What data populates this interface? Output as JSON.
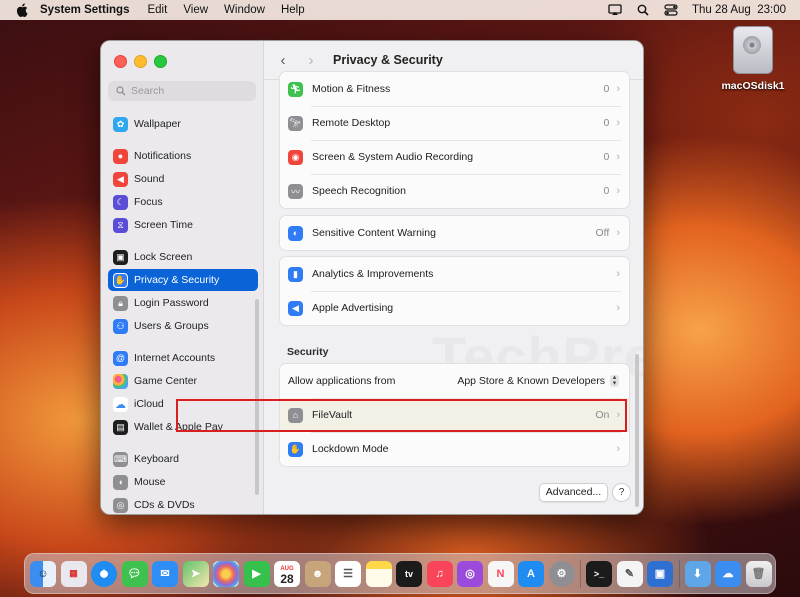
{
  "menubar": {
    "app": "System Settings",
    "items": [
      "Edit",
      "View",
      "Window",
      "Help"
    ],
    "clock": "Thu 28 Aug  23:00"
  },
  "desktop": {
    "disk_label": "macOSdisk1"
  },
  "watermark": "TechPress.net",
  "sidebar": {
    "search_placeholder": "Search",
    "items": [
      {
        "label": "Wallpaper",
        "icon": "wallpaper-icon",
        "color": "#2fa8f0"
      },
      {
        "label": "Notifications",
        "icon": "notifications-icon",
        "color": "#f0453a"
      },
      {
        "label": "Sound",
        "icon": "sound-icon",
        "color": "#f0453a"
      },
      {
        "label": "Focus",
        "icon": "focus-icon",
        "color": "#5b4ed6"
      },
      {
        "label": "Screen Time",
        "icon": "screen-time-icon",
        "color": "#5b4ed6"
      },
      {
        "label": "Lock Screen",
        "icon": "lock-screen-icon",
        "color": "#1e1e1e"
      },
      {
        "label": "Privacy & Security",
        "icon": "privacy-hand-icon",
        "color": "#2f7cf6"
      },
      {
        "label": "Login Password",
        "icon": "login-password-icon",
        "color": "#8e8e93"
      },
      {
        "label": "Users & Groups",
        "icon": "users-groups-icon",
        "color": "#2f7cf6"
      },
      {
        "label": "Internet Accounts",
        "icon": "internet-accounts-icon",
        "color": "#2f7cf6"
      },
      {
        "label": "Game Center",
        "icon": "game-center-icon",
        "color": "#e9e9ee"
      },
      {
        "label": "iCloud",
        "icon": "icloud-icon",
        "color": "#ffffff"
      },
      {
        "label": "Wallet & Apple Pay",
        "icon": "wallet-icon",
        "color": "#1e1e1e"
      },
      {
        "label": "Keyboard",
        "icon": "keyboard-icon",
        "color": "#8e8e93"
      },
      {
        "label": "Mouse",
        "icon": "mouse-icon",
        "color": "#8e8e93"
      },
      {
        "label": "CDs & DVDs",
        "icon": "cds-dvds-icon",
        "color": "#8e8e93"
      }
    ]
  },
  "main": {
    "title": "Privacy & Security",
    "group1": [
      {
        "label": "Motion & Fitness",
        "value": "0",
        "icon": "motion-fitness-icon",
        "color": "#3fc14f"
      },
      {
        "label": "Remote Desktop",
        "value": "0",
        "icon": "remote-desktop-icon",
        "color": "#8e8e93"
      },
      {
        "label": "Screen & System Audio Recording",
        "value": "0",
        "icon": "screen-recording-icon",
        "color": "#f0453a"
      },
      {
        "label": "Speech Recognition",
        "value": "0",
        "icon": "speech-recognition-icon",
        "color": "#8e8e93"
      }
    ],
    "sensitive": {
      "label": "Sensitive Content Warning",
      "value": "Off",
      "icon": "sensitive-content-icon",
      "color": "#2f7cf6"
    },
    "group3": [
      {
        "label": "Analytics & Improvements",
        "icon": "analytics-icon",
        "color": "#2f7cf6"
      },
      {
        "label": "Apple Advertising",
        "icon": "advertising-icon",
        "color": "#2f7cf6"
      }
    ],
    "security_header": "Security",
    "allow_label": "Allow applications from",
    "allow_value": "App Store & Known Developers",
    "filevault": {
      "label": "FileVault",
      "value": "On",
      "icon": "filevault-icon",
      "color": "#8e8e93"
    },
    "lockdown": {
      "label": "Lockdown Mode",
      "icon": "lockdown-hand-icon",
      "color": "#2f7cf6"
    },
    "advanced_button": "Advanced...",
    "help_button": "?"
  },
  "dock": {
    "calendar_day": "28",
    "calendar_month": "AUG",
    "apps": [
      {
        "name": "finder-icon",
        "color": "#3b8ef0"
      },
      {
        "name": "launchpad-icon",
        "color": "#e8e8ee"
      },
      {
        "name": "safari-icon",
        "color": "#1e8cf0"
      },
      {
        "name": "messages-icon",
        "color": "#3fc14f"
      },
      {
        "name": "mail-icon",
        "color": "#2f8ef5"
      },
      {
        "name": "maps-icon",
        "color": "#62c26b"
      },
      {
        "name": "photos-icon",
        "color": "#f6f6f6"
      },
      {
        "name": "facetime-icon",
        "color": "#36c14c"
      },
      {
        "name": "calendar-icon",
        "color": "#ffffff"
      },
      {
        "name": "contacts-icon",
        "color": "#c7a57b"
      },
      {
        "name": "reminders-icon",
        "color": "#ffffff"
      },
      {
        "name": "notes-icon",
        "color": "#ffd84a"
      },
      {
        "name": "apple-tv-icon",
        "color": "#1b1b1b"
      },
      {
        "name": "music-icon",
        "color": "#f9455a"
      },
      {
        "name": "podcasts-icon",
        "color": "#9b4bdc"
      },
      {
        "name": "news-icon",
        "color": "#f6f6f6"
      },
      {
        "name": "app-store-icon",
        "color": "#1e8cf0"
      },
      {
        "name": "system-settings-icon",
        "color": "#8e8e93"
      },
      {
        "name": "terminal-icon",
        "color": "#1b1b1b"
      },
      {
        "name": "textedit-icon",
        "color": "#f4f4f4"
      },
      {
        "name": "remote-desktop-app-icon",
        "color": "#2f6fd1"
      },
      {
        "name": "downloads-folder-icon",
        "color": "#5fa6e8"
      },
      {
        "name": "icloud-drive-icon",
        "color": "#3b8ef0"
      },
      {
        "name": "trash-icon",
        "color": "#d6d6da"
      }
    ],
    "tv_label": "tv"
  }
}
